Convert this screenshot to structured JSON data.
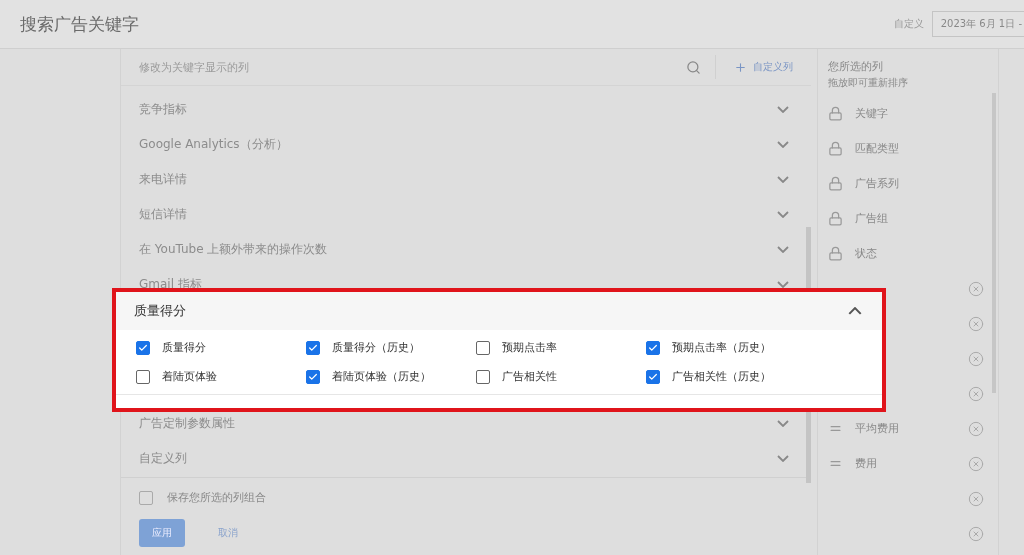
{
  "header": {
    "title": "搜索广告关键字",
    "range_label": "自定义",
    "date": "2023年 6月 1日 -"
  },
  "column_picker": {
    "search_placeholder": "修改为关键字显示的列",
    "custom_column_button": "自定义列",
    "sections": [
      {
        "label": "竞争指标",
        "expanded": false
      },
      {
        "label": "Google Analytics（分析）",
        "expanded": false
      },
      {
        "label": "来电详情",
        "expanded": false
      },
      {
        "label": "短信详情",
        "expanded": false
      },
      {
        "label": "在 YouTube 上额外带来的操作次数",
        "expanded": false
      },
      {
        "label": "Gmail 指标",
        "expanded": false
      },
      {
        "label": "广告定制参数属性",
        "expanded": false
      },
      {
        "label": "自定义列",
        "expanded": false
      }
    ],
    "save_combination": {
      "label": "保存您所选的列组合",
      "checked": false
    },
    "buttons": [
      {
        "label": "应用",
        "kind": "primary"
      },
      {
        "label": "取消",
        "kind": "text"
      }
    ]
  },
  "highlighted_section": {
    "title": "质量得分",
    "expanded": true,
    "options": [
      {
        "label": "质量得分",
        "checked": true
      },
      {
        "label": "质量得分（历史）",
        "checked": true
      },
      {
        "label": "预期点击率",
        "checked": false
      },
      {
        "label": "预期点击率（历史）",
        "checked": true
      },
      {
        "label": "着陆页体验",
        "checked": false
      },
      {
        "label": "着陆页体验（历史）",
        "checked": true
      },
      {
        "label": "广告相关性",
        "checked": false
      },
      {
        "label": "广告相关性（历史）",
        "checked": true
      }
    ]
  },
  "selected_columns": {
    "title": "您所选的列",
    "hint": "拖放即可重新排序",
    "items": [
      {
        "label": "关键字",
        "locked": true
      },
      {
        "label": "匹配类型",
        "locked": true
      },
      {
        "label": "广告系列",
        "locked": true
      },
      {
        "label": "广告组",
        "locked": true
      },
      {
        "label": "状态",
        "locked": true
      },
      {
        "locked": false
      },
      {
        "locked": false
      },
      {
        "locked": false
      },
      {
        "locked": false
      },
      {
        "label": "平均费用",
        "locked": false
      },
      {
        "label": "费用",
        "locked": false
      },
      {
        "locked": false
      },
      {
        "locked": false
      }
    ]
  }
}
